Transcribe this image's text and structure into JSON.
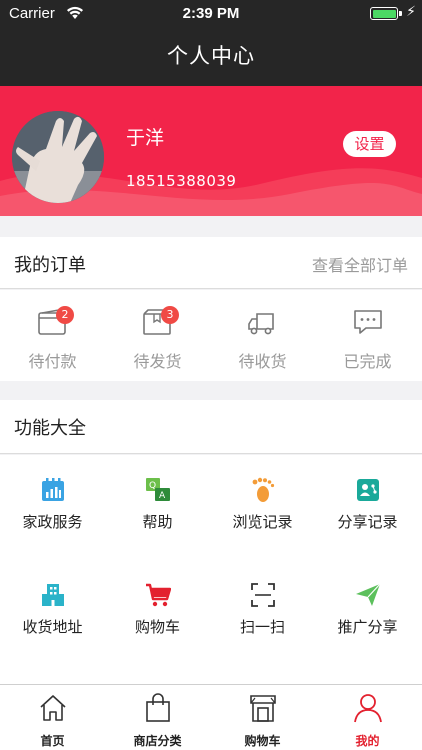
{
  "status_bar": {
    "carrier": "Carrier",
    "time": "2:39 PM",
    "battery_level": 1.0
  },
  "nav": {
    "title": "个人中心"
  },
  "profile": {
    "name": "于洋",
    "phone": "18515388039",
    "settings_label": "设置"
  },
  "orders": {
    "title": "我的订单",
    "view_all": "查看全部订单",
    "items": [
      {
        "label": "待付款",
        "badge": "2",
        "icon": "wallet-icon"
      },
      {
        "label": "待发货",
        "badge": "3",
        "icon": "package-icon"
      },
      {
        "label": "待收货",
        "badge": "",
        "icon": "truck-icon"
      },
      {
        "label": "已完成",
        "badge": "",
        "icon": "chat-icon"
      }
    ]
  },
  "features": {
    "title": "功能大全",
    "items": [
      {
        "label": "家政服务",
        "icon": "calendar-chart-icon",
        "color": "#3aa3e3"
      },
      {
        "label": "帮助",
        "icon": "qa-chat-icon",
        "color": "#4caf50"
      },
      {
        "label": "浏览记录",
        "icon": "footprint-icon",
        "color": "#f39c38"
      },
      {
        "label": "分享记录",
        "icon": "share-users-icon",
        "color": "#1aa99a"
      },
      {
        "label": "收货地址",
        "icon": "building-icon",
        "color": "#2ab3c9"
      },
      {
        "label": "购物车",
        "icon": "cart-icon",
        "color": "#e3212f"
      },
      {
        "label": "扫一扫",
        "icon": "scan-icon",
        "color": "#333333"
      },
      {
        "label": "推广分享",
        "icon": "paper-plane-icon",
        "color": "#5cc05c"
      }
    ]
  },
  "tabbar": {
    "items": [
      {
        "label": "首页",
        "icon": "home-icon",
        "active": false
      },
      {
        "label": "商店分类",
        "icon": "shopping-bag-icon",
        "active": false
      },
      {
        "label": "购物车",
        "icon": "store-icon",
        "active": false
      },
      {
        "label": "我的",
        "icon": "person-icon",
        "active": true
      }
    ],
    "active_color": "#e3212f"
  }
}
